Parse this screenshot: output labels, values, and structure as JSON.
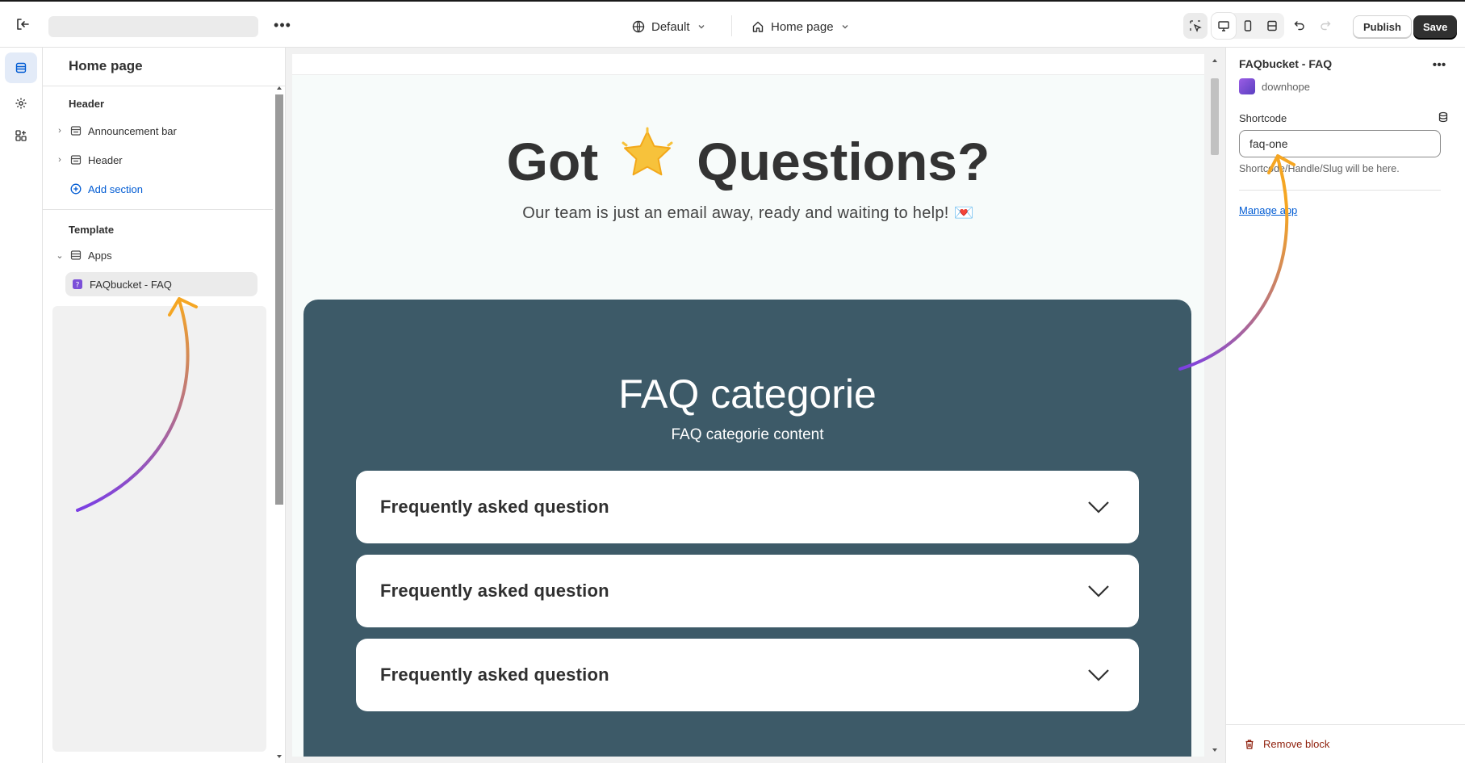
{
  "topbar": {
    "theme_label": "Default",
    "page_label": "Home page",
    "publish_label": "Publish",
    "save_label": "Save",
    "more_label": "•••"
  },
  "sidebar": {
    "title": "Home page",
    "header_group": "Header",
    "header_items": [
      {
        "label": "Announcement bar",
        "icon": "section-icon"
      },
      {
        "label": "Header",
        "icon": "section-icon"
      }
    ],
    "add_section": "Add section",
    "template_group": "Template",
    "apps_label": "Apps",
    "selected_block": "FAQbucket - FAQ"
  },
  "preview": {
    "hero_title_left": "Got",
    "hero_emoji": "🌟",
    "hero_title_right": "Questions?",
    "hero_subtitle": "Our team is just an email away, ready and waiting to help! 💌",
    "faq_title": "FAQ categorie",
    "faq_content": "FAQ categorie content",
    "questions": [
      "Frequently asked question",
      "Frequently asked question",
      "Frequently asked question"
    ],
    "section_bg": "#3d5a68"
  },
  "panel": {
    "title": "FAQbucket - FAQ",
    "app_name": "downhope",
    "shortcode_label": "Shortcode",
    "shortcode_value": "faq-one",
    "help_text": "Shortcode/Handle/Slug will be here.",
    "manage_app": "Manage app",
    "remove_block": "Remove block",
    "more_label": "•••"
  },
  "colors": {
    "accent": "#005bd3",
    "danger": "#8e1f0b",
    "arrow_start": "#7b3fe4",
    "arrow_end": "#f5a623"
  }
}
